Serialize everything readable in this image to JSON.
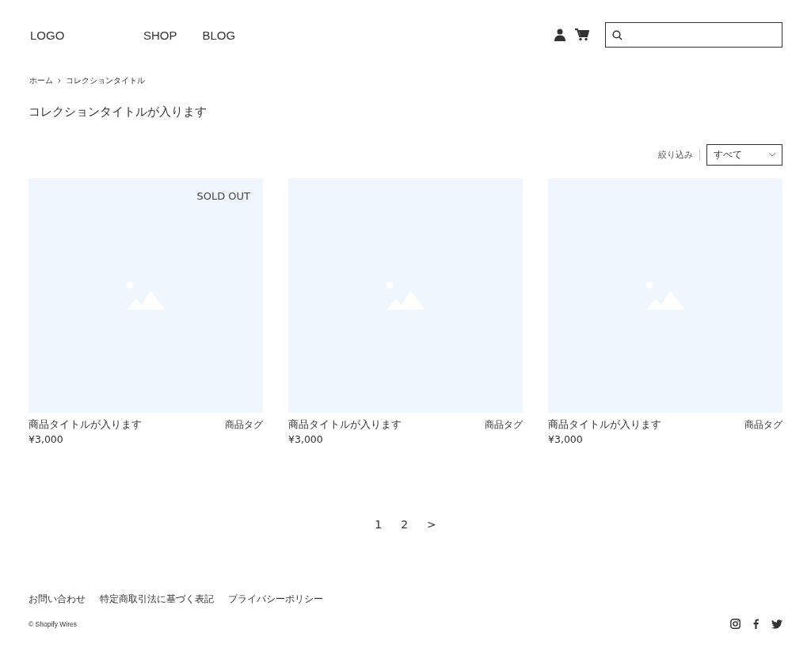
{
  "header": {
    "logo": "LOGO",
    "nav": [
      "SHOP",
      "BLOG"
    ]
  },
  "breadcrumb": [
    "ホーム",
    "コレクションタイトル"
  ],
  "collection_title": "コレクションタイトルが入ります",
  "filter": {
    "label": "絞り込み",
    "value": "すべて"
  },
  "products": [
    {
      "title": "商品タイトルが入ります",
      "tag": "商品タグ",
      "price": "¥3,000",
      "sold_out": true
    },
    {
      "title": "商品タイトルが入ります",
      "tag": "商品タグ",
      "price": "¥3,000",
      "sold_out": false
    },
    {
      "title": "商品タイトルが入ります",
      "tag": "商品タグ",
      "price": "¥3,000",
      "sold_out": false
    }
  ],
  "sold_out_label": "SOLD OUT",
  "pagination": [
    "1",
    "2",
    ">"
  ],
  "footer": {
    "links": [
      "お問い合わせ",
      "特定商取引法に基づく表記",
      "プライバシーポリシー"
    ],
    "copyright": "© Shopify Wires"
  }
}
